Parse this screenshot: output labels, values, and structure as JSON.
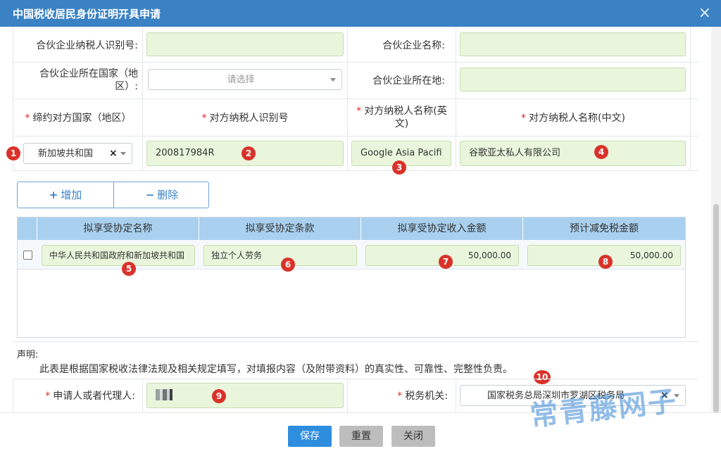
{
  "window": {
    "title": "中国税收居民身份证明开具申请",
    "close_icon": "×"
  },
  "partner": {
    "tin_label": "合伙企业纳税人识别号:",
    "tin_value": "",
    "name_label": "合伙企业名称:",
    "name_value": "",
    "country_label_line1": "合伙企业所在国家（地",
    "country_label_line2": "区）:",
    "country_placeholder": "请选择",
    "location_label": "合伙企业所在地:",
    "location_value": ""
  },
  "counterparty": {
    "headers": {
      "country": "缔约对方国家（地区）",
      "tin": "对方纳税人识别号",
      "name_en_line1": "对方纳税人名称(英",
      "name_en_line2": "文)",
      "name_cn": "对方纳税人名称(中文)"
    },
    "country_value": "新加坡共和国",
    "clear_icon": "×",
    "tin_value": "200817984R",
    "name_en_value": "Google Asia Pacifi",
    "name_cn_value": "谷歌亚太私人有限公司"
  },
  "buttons": {
    "add_label": "增加",
    "delete_label": "删除"
  },
  "treaty_table": {
    "columns": [
      "拟享受协定名称",
      "拟享受协定条款",
      "拟享受协定收入金额",
      "预计减免税金额"
    ],
    "rows": [
      {
        "treaty_name": "中华人民共和国政府和新加坡共和国",
        "article": "独立个人劳务",
        "income": "50,000.00",
        "relief": "50,000.00"
      }
    ]
  },
  "declaration": {
    "title": "声明:",
    "text": "此表是根据国家税收法律法规及相关规定填写，对填报内容（及附带资料）的真实性、可靠性、完整性负责。"
  },
  "applicant": {
    "label": "申请人或者代理人:",
    "value": ""
  },
  "tax_office": {
    "label": "税务机关:",
    "value": "国家税务总局深圳市罗湖区税务局"
  },
  "badges": [
    "1",
    "2",
    "3",
    "4",
    "5",
    "6",
    "7",
    "8",
    "9",
    "10"
  ],
  "footer": {
    "save": "保存",
    "reset": "重置",
    "close": "关闭"
  },
  "watermark": "常青藤网子",
  "colors": {
    "titlebar": "#3a82c4",
    "input_bg": "#e9f6dc",
    "grid_header": "#a9d0ef",
    "primary_button": "#2e8ede",
    "badge": "#d9322a"
  }
}
